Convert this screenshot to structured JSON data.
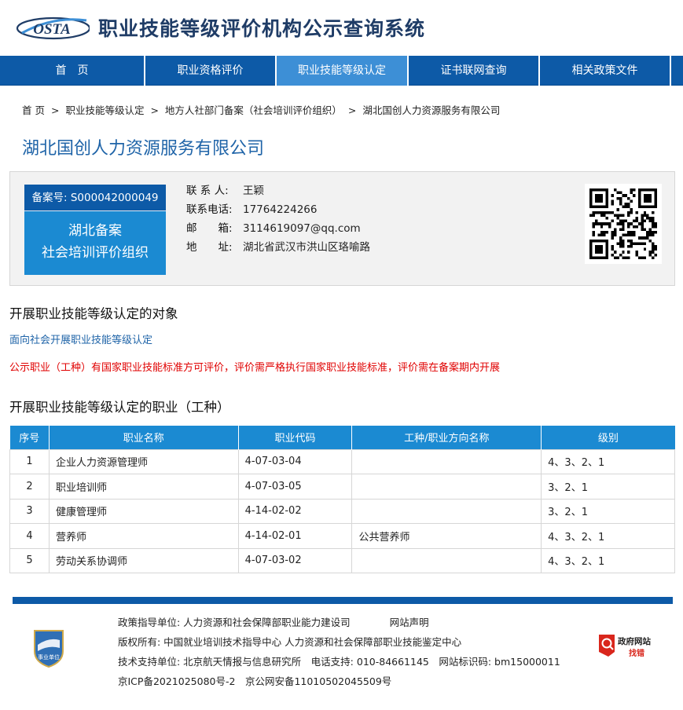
{
  "header": {
    "logo_text": "OSTA",
    "site_title": "职业技能等级评价机构公示查询系统"
  },
  "nav": [
    {
      "label": "首　页"
    },
    {
      "label": "职业资格评价"
    },
    {
      "label": "职业技能等级认定"
    },
    {
      "label": "证书联网查询"
    },
    {
      "label": "相关政策文件"
    }
  ],
  "breadcrumb": [
    "首 页",
    ">",
    "职业技能等级认定",
    ">",
    "地方人社部门备案（社会培训评价组织）",
    ">",
    "湖北国创人力资源服务有限公司"
  ],
  "org_title": "湖北国创人力资源服务有限公司",
  "registration": {
    "number_label": "备案号:",
    "number": "S000042000049",
    "line1": "湖北备案",
    "line2": "社会培训评价组织"
  },
  "contact": {
    "person_label": "联 系 人:",
    "person": "王颖",
    "phone_label": "联系电话:",
    "phone": "17764224266",
    "email_label": "邮　　箱:",
    "email": "3114619097@qq.com",
    "address_label": "地　　址:",
    "address": "湖北省武汉市洪山区珞喻路"
  },
  "section1": {
    "heading": "开展职业技能等级认定的对象",
    "target": "面向社会开展职业技能等级认定",
    "notice": "公示职业（工种）有国家职业技能标准方可评价，评价需严格执行国家职业技能标准，评价需在备案期内开展"
  },
  "section2": {
    "heading": "开展职业技能等级认定的职业（工种）"
  },
  "table": {
    "headers": [
      "序号",
      "职业名称",
      "职业代码",
      "工种/职业方向名称",
      "级别"
    ],
    "rows": [
      [
        "1",
        "企业人力资源管理师",
        "4-07-03-04",
        "",
        "4、3、2、1"
      ],
      [
        "2",
        "职业培训师",
        "4-07-03-05",
        "",
        "3、2、1"
      ],
      [
        "3",
        "健康管理师",
        "4-14-02-02",
        "",
        "3、2、1"
      ],
      [
        "4",
        "营养师",
        "4-14-02-01",
        "公共营养师",
        "4、3、2、1"
      ],
      [
        "5",
        "劳动关系协调师",
        "4-07-03-02",
        "",
        "4、3、2、1"
      ]
    ]
  },
  "footer": {
    "badge_text": "事业单位",
    "row1_a": "政策指导单位: 人力资源和社会保障部职业能力建设司",
    "row1_b": "网站声明",
    "row2": "版权所有: 中国就业培训技术指导中心 人力资源和社会保障部职业技能鉴定中心",
    "row3": "技术支持单位: 北京航天情报与信息研究所　电话支持: 010-84661145　网站标识码: bm15000011",
    "row4": "京ICP备2021025080号-2　京公网安备11010502045509号",
    "gov_title": "政府网站",
    "gov_sub": "找错"
  },
  "colors": {
    "nav_bg": "#0d5aa7",
    "nav_active": "#3d8fd6",
    "table_header": "#1b8ad2",
    "title_blue": "#1f64a8",
    "notice_red": "#e00000"
  }
}
